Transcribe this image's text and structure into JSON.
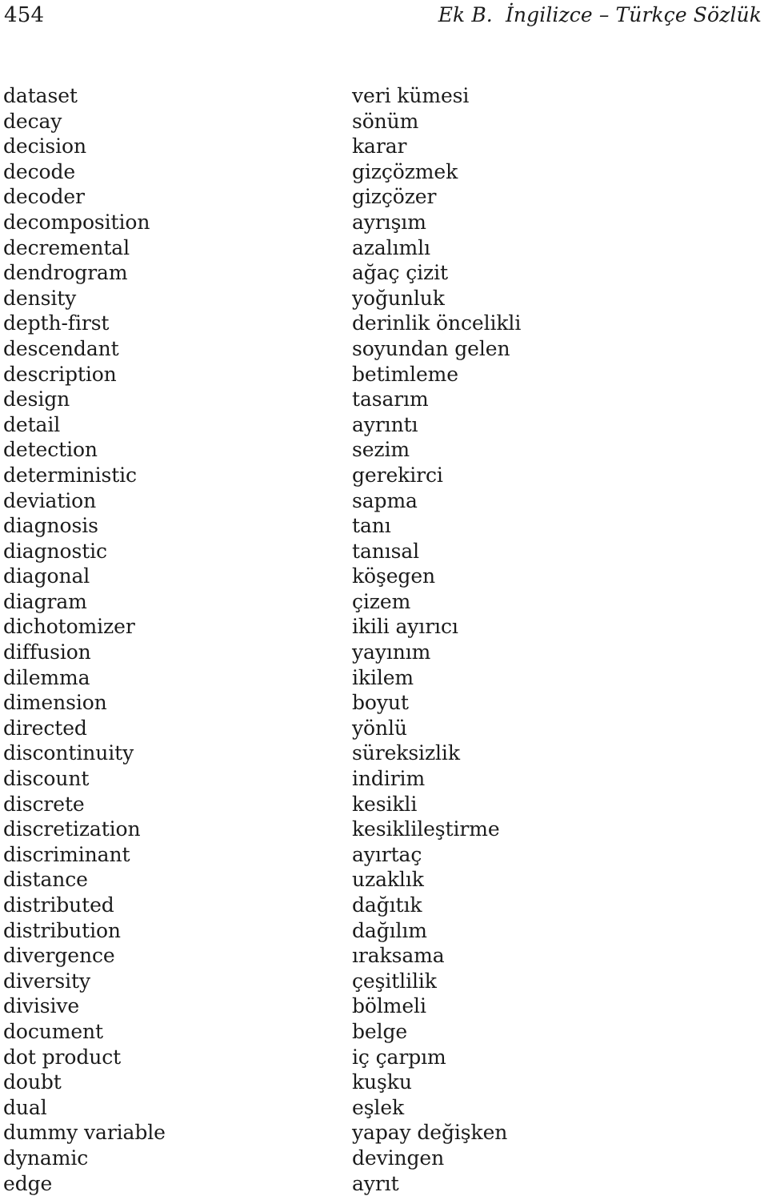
{
  "header": {
    "folio": "454",
    "title": "Ek B.  İngilizce – Türkçe Sözlük"
  },
  "glossary": {
    "language_pair": "English – Turkish",
    "entries": [
      {
        "term": "dataset",
        "translation": "veri kümesi"
      },
      {
        "term": "decay",
        "translation": "sönüm"
      },
      {
        "term": "decision",
        "translation": "karar"
      },
      {
        "term": "decode",
        "translation": "gizçözmek"
      },
      {
        "term": "decoder",
        "translation": "gizçözer"
      },
      {
        "term": "decomposition",
        "translation": "ayrışım"
      },
      {
        "term": "decremental",
        "translation": "azalımlı"
      },
      {
        "term": "dendrogram",
        "translation": "ağaç çizit"
      },
      {
        "term": "density",
        "translation": "yoğunluk"
      },
      {
        "term": "depth-first",
        "translation": "derinlik öncelikli"
      },
      {
        "term": "descendant",
        "translation": "soyundan gelen"
      },
      {
        "term": "description",
        "translation": "betimleme"
      },
      {
        "term": "design",
        "translation": "tasarım"
      },
      {
        "term": "detail",
        "translation": "ayrıntı"
      },
      {
        "term": "detection",
        "translation": "sezim"
      },
      {
        "term": "deterministic",
        "translation": "gerekirci"
      },
      {
        "term": "deviation",
        "translation": "sapma"
      },
      {
        "term": "diagnosis",
        "translation": "tanı"
      },
      {
        "term": "diagnostic",
        "translation": "tanısal"
      },
      {
        "term": "diagonal",
        "translation": "köşegen"
      },
      {
        "term": "diagram",
        "translation": "çizem"
      },
      {
        "term": "dichotomizer",
        "translation": "ikili ayırıcı"
      },
      {
        "term": "diffusion",
        "translation": "yayınım"
      },
      {
        "term": "dilemma",
        "translation": "ikilem"
      },
      {
        "term": "dimension",
        "translation": "boyut"
      },
      {
        "term": "directed",
        "translation": "yönlü"
      },
      {
        "term": "discontinuity",
        "translation": "süreksizlik"
      },
      {
        "term": "discount",
        "translation": "indirim"
      },
      {
        "term": "discrete",
        "translation": "kesikli"
      },
      {
        "term": "discretization",
        "translation": "kesiklileştirme"
      },
      {
        "term": "discriminant",
        "translation": "ayırtaç"
      },
      {
        "term": "distance",
        "translation": "uzaklık"
      },
      {
        "term": "distributed",
        "translation": "dağıtık"
      },
      {
        "term": "distribution",
        "translation": "dağılım"
      },
      {
        "term": "divergence",
        "translation": "ıraksama"
      },
      {
        "term": "diversity",
        "translation": "çeşitlilik"
      },
      {
        "term": "divisive",
        "translation": "bölmeli"
      },
      {
        "term": "document",
        "translation": "belge"
      },
      {
        "term": "dot product",
        "translation": "iç çarpım"
      },
      {
        "term": "doubt",
        "translation": "kuşku"
      },
      {
        "term": "dual",
        "translation": "eşlek"
      },
      {
        "term": "dummy variable",
        "translation": "yapay değişken"
      },
      {
        "term": "dynamic",
        "translation": "devingen"
      },
      {
        "term": "edge",
        "translation": "ayrıt"
      }
    ]
  },
  "colors": {
    "text": "#1b1b1b",
    "background": "#ffffff"
  }
}
